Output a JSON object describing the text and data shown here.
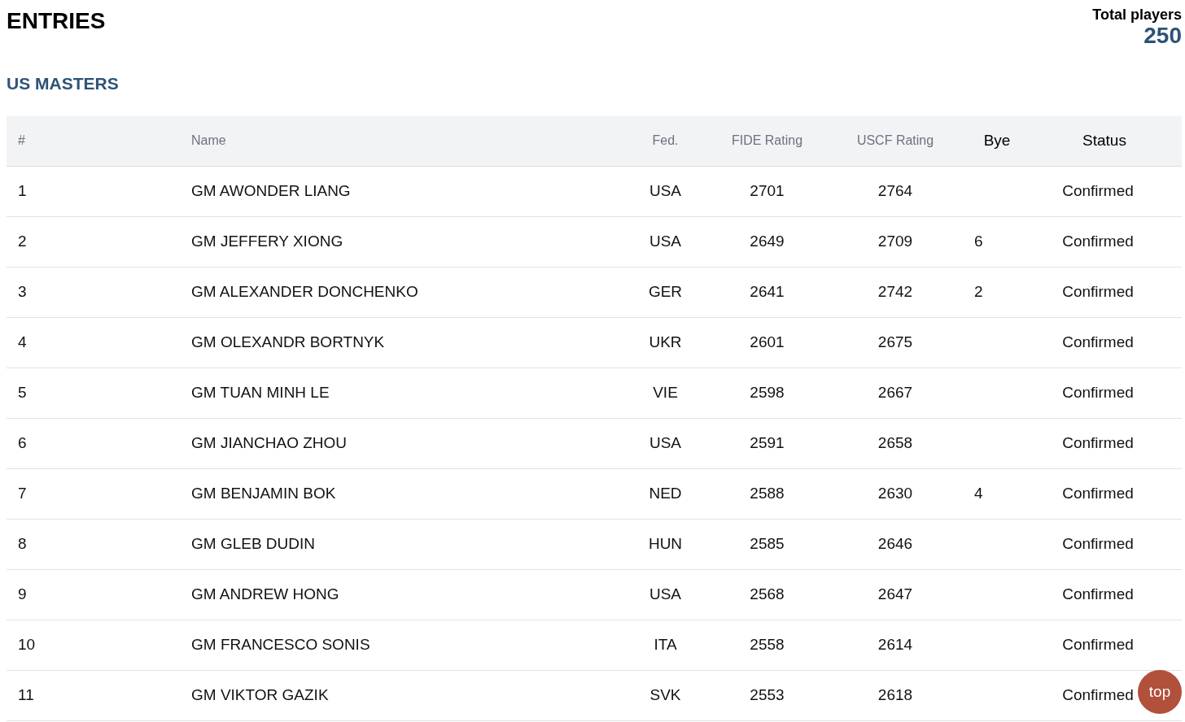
{
  "title": "ENTRIES",
  "section": "US MASTERS",
  "total": {
    "label": "Total players",
    "value": "250"
  },
  "table": {
    "columns": [
      "#",
      "Name",
      "Fed.",
      "FIDE Rating",
      "USCF Rating",
      "Bye",
      "Status"
    ],
    "rows": [
      [
        "1",
        "GM AWONDER LIANG",
        "USA",
        "2701",
        "2764",
        "",
        "Confirmed"
      ],
      [
        "2",
        "GM JEFFERY XIONG",
        "USA",
        "2649",
        "2709",
        "6",
        "Confirmed"
      ],
      [
        "3",
        "GM ALEXANDER DONCHENKO",
        "GER",
        "2641",
        "2742",
        "2",
        "Confirmed"
      ],
      [
        "4",
        "GM OLEXANDR BORTNYK",
        "UKR",
        "2601",
        "2675",
        "",
        "Confirmed"
      ],
      [
        "5",
        "GM TUAN MINH LE",
        "VIE",
        "2598",
        "2667",
        "",
        "Confirmed"
      ],
      [
        "6",
        "GM JIANCHAO ZHOU",
        "USA",
        "2591",
        "2658",
        "",
        "Confirmed"
      ],
      [
        "7",
        "GM BENJAMIN BOK",
        "NED",
        "2588",
        "2630",
        "4",
        "Confirmed"
      ],
      [
        "8",
        "GM GLEB DUDIN",
        "HUN",
        "2585",
        "2646",
        "",
        "Confirmed"
      ],
      [
        "9",
        "GM ANDREW HONG",
        "USA",
        "2568",
        "2647",
        "",
        "Confirmed"
      ],
      [
        "10",
        "GM FRANCESCO SONIS",
        "ITA",
        "2558",
        "2614",
        "",
        "Confirmed"
      ],
      [
        "11",
        "GM VIKTOR GAZIK",
        "SVK",
        "2553",
        "2618",
        "",
        "Confirmed"
      ]
    ]
  },
  "back_to_top": "top"
}
